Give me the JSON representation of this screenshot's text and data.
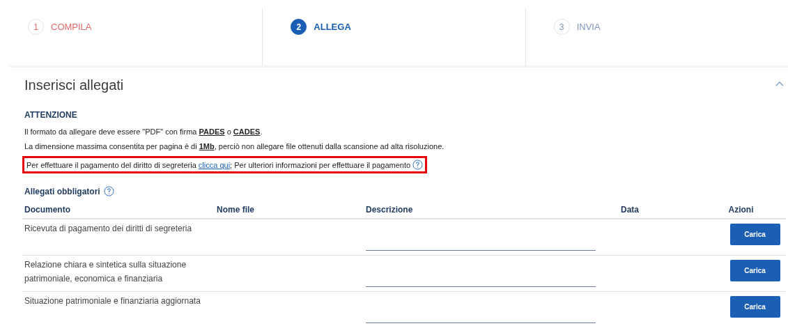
{
  "steps": [
    {
      "number": "1",
      "label": "COMPILA",
      "kind": "done"
    },
    {
      "number": "2",
      "label": "ALLEGA",
      "kind": "active"
    },
    {
      "number": "3",
      "label": "INVIA",
      "kind": "pending"
    }
  ],
  "section": {
    "title": "Inserisci allegati",
    "expanded": true
  },
  "notice": {
    "heading": "ATTENZIONE",
    "lines": [
      "Il formato da allegare deve essere \"PDF\" con firma **PADES** o **CADES**.",
      "La dimensione massima consentita per pagina è di **1Mb**, perciò non allegare file ottenuti dalla scansione ad alta risoluzione."
    ],
    "payment": {
      "before": "Per effettuare il pagamento del diritto di segreteria",
      "link": "clicca qui",
      "after": "; Per ulteriori informazioni per effettuare il pagamento",
      "highlighted": true
    }
  },
  "table": {
    "title": "Allegati obbligatori",
    "columns": [
      "Documento",
      "Nome file",
      "Descrizione",
      "Data",
      "Azioni"
    ],
    "rows": [
      {
        "document": "Ricevuta di pagamento dei diritti di segreteria",
        "action": "Carica"
      },
      {
        "document": "Relazione chiara e sintetica sulla situazione patrimoniale, economica e finanziaria",
        "action": "Carica"
      },
      {
        "document": "Situazione patrimoniale e finanziaria aggiornata",
        "action": "Carica"
      }
    ]
  }
}
